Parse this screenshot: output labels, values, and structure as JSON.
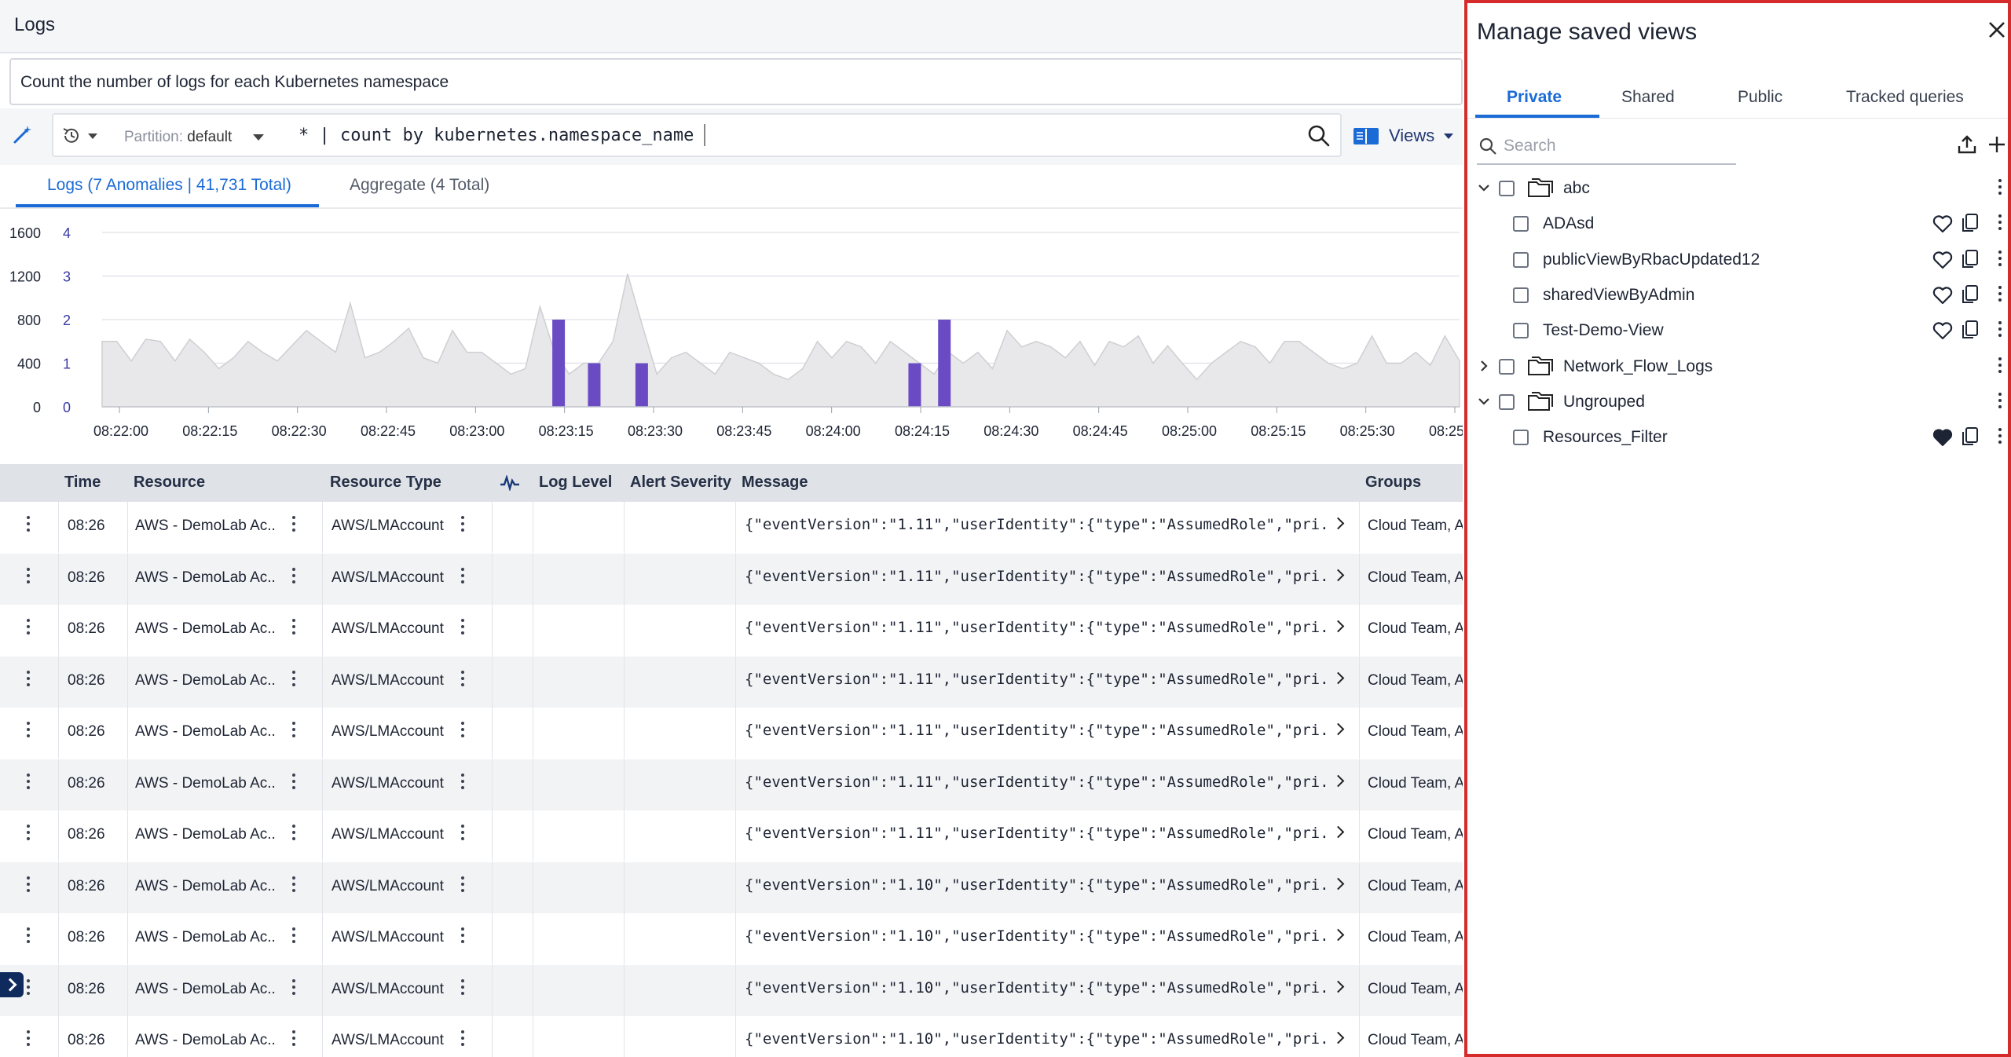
{
  "app": {
    "title": "Logs"
  },
  "nl_query": "Count the number of logs for each Kubernetes namespace",
  "query_bar": {
    "partition_label": "Partition:",
    "partition_value": "default",
    "query": "* | count by kubernetes.namespace_name",
    "views_label": "Views"
  },
  "tabs": {
    "logs": "Logs (7 Anomalies | 41,731 Total)",
    "aggregate": "Aggregate (4 Total)"
  },
  "chart_data": {
    "type": "area",
    "y_left_ticks": [
      "0",
      "400",
      "800",
      "1200",
      "1600"
    ],
    "y_right_ticks": [
      "0",
      "1",
      "2",
      "3",
      "4"
    ],
    "x_ticks": [
      "08:22:00",
      "08:22:15",
      "08:22:30",
      "08:22:45",
      "08:23:00",
      "08:23:15",
      "08:23:30",
      "08:23:45",
      "08:24:00",
      "08:24:15",
      "08:24:30",
      "08:24:45",
      "08:25:00",
      "08:25:15",
      "08:25:30",
      "08:25:45"
    ],
    "ylim": [
      0,
      1600
    ],
    "ylim_right": [
      0,
      4
    ],
    "x_start_seconds": 0,
    "x_step_seconds": 5,
    "series": [
      {
        "values": [
          600,
          600,
          420,
          620,
          600,
          420,
          620,
          500,
          350,
          450,
          600,
          500,
          420,
          560,
          700,
          600,
          500,
          950,
          450,
          500,
          600,
          720,
          450,
          400,
          700,
          500,
          500,
          400,
          300,
          350,
          920,
          500,
          300,
          400,
          400,
          600,
          1220,
          750,
          300,
          450,
          500,
          400,
          300,
          500,
          450,
          400,
          300,
          250,
          350,
          600,
          450,
          600,
          550,
          400,
          600,
          500,
          400,
          300,
          500,
          400,
          500,
          350,
          700,
          550,
          600,
          550,
          450,
          600,
          380,
          600,
          550,
          650,
          400,
          560,
          400,
          250,
          400,
          500,
          600,
          550,
          400,
          600,
          600,
          500,
          400,
          350,
          400,
          650,
          400,
          400,
          500,
          380,
          650,
          420
        ]
      }
    ],
    "anomalies": [
      {
        "x": "08:23:14",
        "count": 2
      },
      {
        "x": "08:23:20",
        "count": 1
      },
      {
        "x": "08:23:28",
        "count": 1
      },
      {
        "x": "08:24:14",
        "count": 1
      },
      {
        "x": "08:24:19",
        "count": 2
      }
    ],
    "colors": {
      "area": "#e8e8ea",
      "line": "#cfcfd3",
      "anomaly": "#6a4bc4",
      "grid": "#e3e5ea"
    }
  },
  "table": {
    "columns": [
      "Time",
      "Resource",
      "Resource Type",
      "Log Level",
      "Alert Severity",
      "Message",
      "Groups"
    ],
    "rows": [
      {
        "time": "08:26",
        "resource": "AWS - DemoLab Ac...",
        "resource_type": "AWS/LMAccount",
        "message": "{\"eventVersion\":\"1.11\",\"userIdentity\":{\"type\":\"AssumedRole\",\"pri...",
        "groups": "Cloud Team, A"
      },
      {
        "time": "08:26",
        "resource": "AWS - DemoLab Ac...",
        "resource_type": "AWS/LMAccount",
        "message": "{\"eventVersion\":\"1.11\",\"userIdentity\":{\"type\":\"AssumedRole\",\"pri...",
        "groups": "Cloud Team, A"
      },
      {
        "time": "08:26",
        "resource": "AWS - DemoLab Ac...",
        "resource_type": "AWS/LMAccount",
        "message": "{\"eventVersion\":\"1.11\",\"userIdentity\":{\"type\":\"AssumedRole\",\"pri...",
        "groups": "Cloud Team, A"
      },
      {
        "time": "08:26",
        "resource": "AWS - DemoLab Ac...",
        "resource_type": "AWS/LMAccount",
        "message": "{\"eventVersion\":\"1.11\",\"userIdentity\":{\"type\":\"AssumedRole\",\"pri...",
        "groups": "Cloud Team, A"
      },
      {
        "time": "08:26",
        "resource": "AWS - DemoLab Ac...",
        "resource_type": "AWS/LMAccount",
        "message": "{\"eventVersion\":\"1.11\",\"userIdentity\":{\"type\":\"AssumedRole\",\"pri...",
        "groups": "Cloud Team, A"
      },
      {
        "time": "08:26",
        "resource": "AWS - DemoLab Ac...",
        "resource_type": "AWS/LMAccount",
        "message": "{\"eventVersion\":\"1.11\",\"userIdentity\":{\"type\":\"AssumedRole\",\"pri...",
        "groups": "Cloud Team, A"
      },
      {
        "time": "08:26",
        "resource": "AWS - DemoLab Ac...",
        "resource_type": "AWS/LMAccount",
        "message": "{\"eventVersion\":\"1.11\",\"userIdentity\":{\"type\":\"AssumedRole\",\"pri...",
        "groups": "Cloud Team, A"
      },
      {
        "time": "08:26",
        "resource": "AWS - DemoLab Ac...",
        "resource_type": "AWS/LMAccount",
        "message": "{\"eventVersion\":\"1.10\",\"userIdentity\":{\"type\":\"AssumedRole\",\"pri...",
        "groups": "Cloud Team, A"
      },
      {
        "time": "08:26",
        "resource": "AWS - DemoLab Ac...",
        "resource_type": "AWS/LMAccount",
        "message": "{\"eventVersion\":\"1.10\",\"userIdentity\":{\"type\":\"AssumedRole\",\"pri...",
        "groups": "Cloud Team, A"
      },
      {
        "time": "08:26",
        "resource": "AWS - DemoLab Ac...",
        "resource_type": "AWS/LMAccount",
        "message": "{\"eventVersion\":\"1.10\",\"userIdentity\":{\"type\":\"AssumedRole\",\"pri...",
        "groups": "Cloud Team, A"
      },
      {
        "time": "08:26",
        "resource": "AWS - DemoLab Ac...",
        "resource_type": "AWS/LMAccount",
        "message": "{\"eventVersion\":\"1.10\",\"userIdentity\":{\"type\":\"AssumedRole\",\"pri...",
        "groups": "Cloud Team, A"
      }
    ]
  },
  "panel": {
    "title": "Manage saved views",
    "tabs": [
      "Private",
      "Shared",
      "Public",
      "Tracked queries"
    ],
    "active_tab": "Private",
    "search_placeholder": "Search",
    "tree": [
      {
        "type": "folder",
        "label": "abc",
        "expanded": true
      },
      {
        "type": "view",
        "label": "ADAsd",
        "favorite": false
      },
      {
        "type": "view",
        "label": "publicViewByRbacUpdated12",
        "favorite": false
      },
      {
        "type": "view",
        "label": "sharedViewByAdmin",
        "favorite": false
      },
      {
        "type": "view",
        "label": "Test-Demo-View",
        "favorite": false
      },
      {
        "type": "folder",
        "label": "Network_Flow_Logs",
        "expanded": false
      },
      {
        "type": "folder",
        "label": "Ungrouped",
        "expanded": true
      },
      {
        "type": "view",
        "label": "Resources_Filter",
        "favorite": true
      }
    ],
    "highlight_color": "#d52b2b"
  }
}
